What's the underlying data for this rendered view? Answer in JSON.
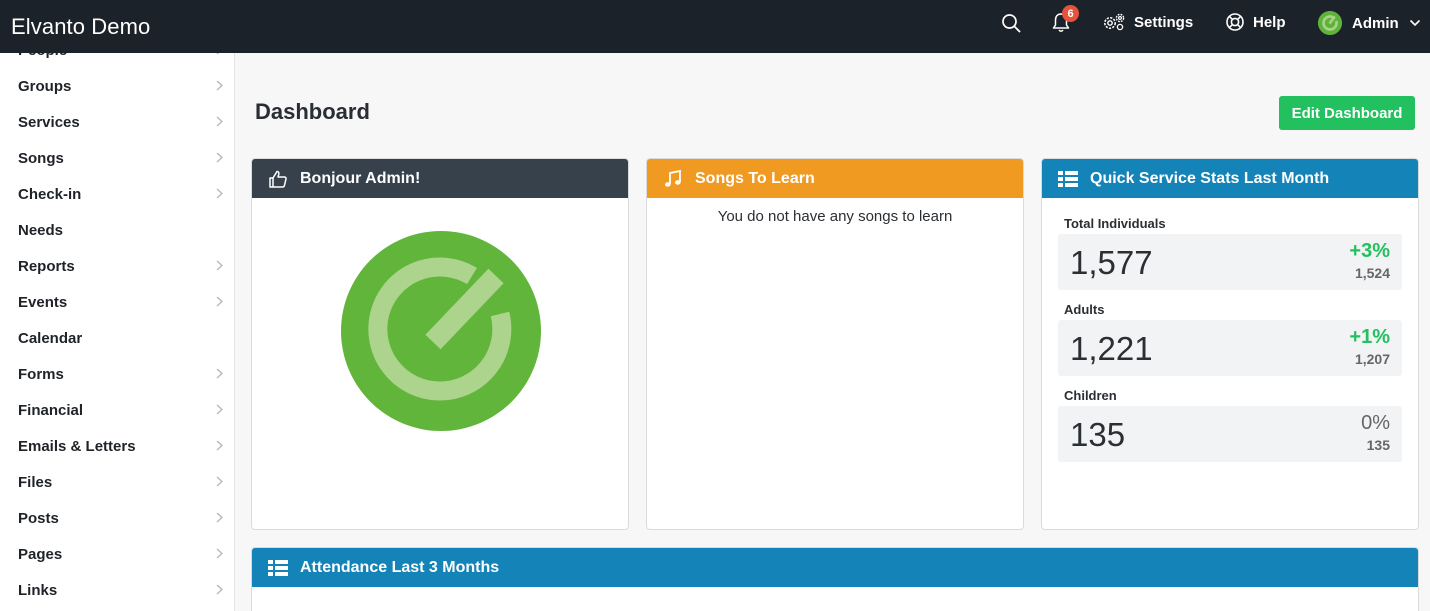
{
  "app": {
    "title": "Elvanto Demo"
  },
  "topbar": {
    "notifications_count": "6",
    "settings_label": "Settings",
    "help_label": "Help",
    "user_label": "Admin"
  },
  "sidebar": {
    "items": [
      {
        "label": "People",
        "has_children": true
      },
      {
        "label": "Groups",
        "has_children": true
      },
      {
        "label": "Services",
        "has_children": true
      },
      {
        "label": "Songs",
        "has_children": true
      },
      {
        "label": "Check-in",
        "has_children": true
      },
      {
        "label": "Needs",
        "has_children": false
      },
      {
        "label": "Reports",
        "has_children": true
      },
      {
        "label": "Events",
        "has_children": true
      },
      {
        "label": "Calendar",
        "has_children": false
      },
      {
        "label": "Forms",
        "has_children": true
      },
      {
        "label": "Financial",
        "has_children": true
      },
      {
        "label": "Emails & Letters",
        "has_children": true
      },
      {
        "label": "Files",
        "has_children": true
      },
      {
        "label": "Posts",
        "has_children": true
      },
      {
        "label": "Pages",
        "has_children": true
      },
      {
        "label": "Links",
        "has_children": true
      }
    ]
  },
  "main": {
    "title": "Dashboard",
    "edit_button": "Edit Dashboard",
    "welcome_card": {
      "title": "Bonjour Admin!"
    },
    "songs_card": {
      "title": "Songs To Learn",
      "message": "You do not have any songs to learn"
    },
    "stats_card": {
      "title": "Quick Service Stats Last Month",
      "stats": [
        {
          "label": "Total Individuals",
          "value": "1,577",
          "change": "+3%",
          "previous": "1,524",
          "trend": "up"
        },
        {
          "label": "Adults",
          "value": "1,221",
          "change": "+1%",
          "previous": "1,207",
          "trend": "up"
        },
        {
          "label": "Children",
          "value": "135",
          "change": "0%",
          "previous": "135",
          "trend": "flat"
        }
      ]
    },
    "attendance_card": {
      "title": "Attendance Last 3 Months"
    }
  },
  "colors": {
    "topbar": "#1c2229",
    "brand_green": "#5fb33a",
    "edit_button": "#22c05f",
    "welcome_header": "#36414c",
    "songs_header": "#f09a22",
    "stats_header": "#1484b8",
    "badge": "#e5533d"
  },
  "icons": {
    "search": "search-icon",
    "notifications": "bell-icon",
    "settings": "gears-icon",
    "help": "lifebuoy-icon",
    "welcome": "thumbs-up-icon",
    "songs": "music-note-icon",
    "stats": "list-icon",
    "attendance": "list-icon"
  }
}
